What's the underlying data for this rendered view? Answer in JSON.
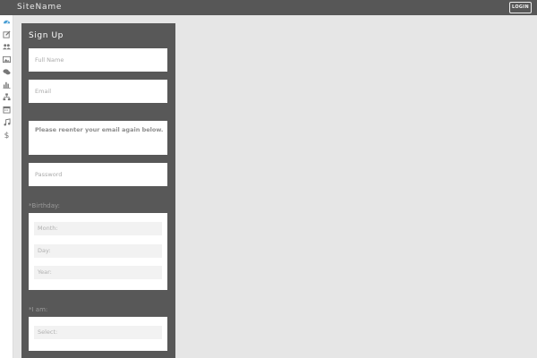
{
  "header": {
    "site_name": "SiteName",
    "login_label": "LOGIN"
  },
  "sidebar": {
    "icons": [
      "dashboard-icon",
      "pencil-square-icon",
      "users-icon",
      "image-icon",
      "chat-icon",
      "bar-chart-icon",
      "sitemap-icon",
      "calendar-icon",
      "music-icon",
      "dollar-icon"
    ],
    "active_color": "#4a9fd5",
    "icon_color": "#777777"
  },
  "signup": {
    "title": "Sign Up",
    "full_name_placeholder": "Full Name",
    "email_placeholder": "Email",
    "reenter_email_placeholder": "Please reenter your email again below.",
    "password_placeholder": "Password",
    "birthday_label": "*Birthday:",
    "month_placeholder": "Month:",
    "day_placeholder": "Day:",
    "year_placeholder": "Year:",
    "i_am_label": "*I am:",
    "select_placeholder": "Select:"
  },
  "colors": {
    "topbar": "#575757",
    "panel": "#585858",
    "background": "#e6e6e6"
  }
}
